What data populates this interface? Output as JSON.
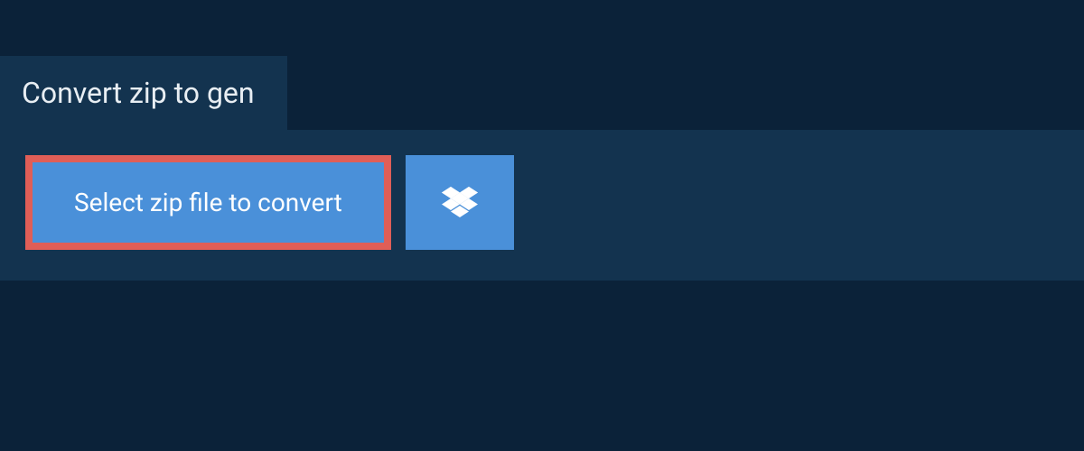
{
  "header": {
    "title": "Convert zip to gen"
  },
  "actions": {
    "select_file_label": "Select zip file to convert"
  }
}
